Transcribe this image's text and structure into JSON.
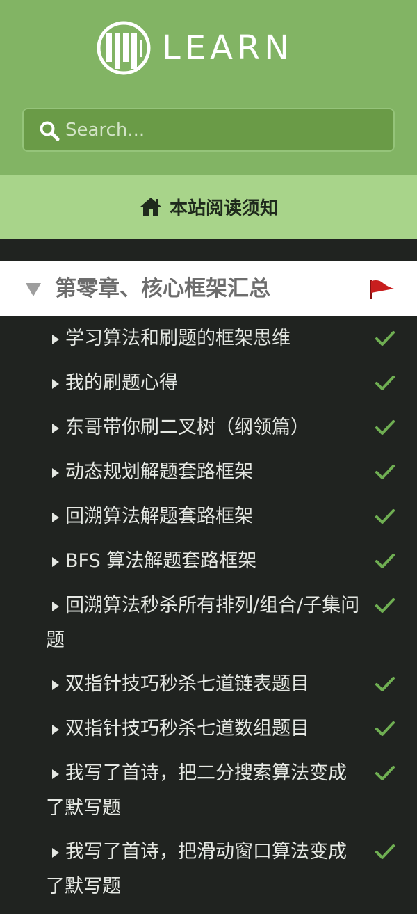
{
  "header": {
    "logo_text": "LEARN"
  },
  "search": {
    "placeholder": "Search..."
  },
  "notice": {
    "label": "本站阅读须知"
  },
  "chapter": {
    "title": "第零章、核心框架汇总"
  },
  "items": [
    {
      "label": "学习算法和刷题的框架思维",
      "done": true
    },
    {
      "label": "我的刷题心得",
      "done": true
    },
    {
      "label": "东哥带你刷二叉树（纲领篇）",
      "done": true
    },
    {
      "label": "动态规划解题套路框架",
      "done": true
    },
    {
      "label": "回溯算法解题套路框架",
      "done": true
    },
    {
      "label": "BFS 算法解题套路框架",
      "done": true
    },
    {
      "label": "回溯算法秒杀所有排列/组合/子集问题",
      "done": true
    },
    {
      "label": "双指针技巧秒杀七道链表题目",
      "done": true
    },
    {
      "label": "双指针技巧秒杀七道数组题目",
      "done": true
    },
    {
      "label": "我写了首诗，把二分搜索算法变成了默写题",
      "done": true
    },
    {
      "label": "我写了首诗，把滑动窗口算法变成了默写题",
      "done": true
    }
  ],
  "colors": {
    "header_bg": "#82b464",
    "notice_bg": "#a8d48a",
    "sidebar_bg": "#202320",
    "check": "#6fae52",
    "flag": "#c81e1e"
  }
}
